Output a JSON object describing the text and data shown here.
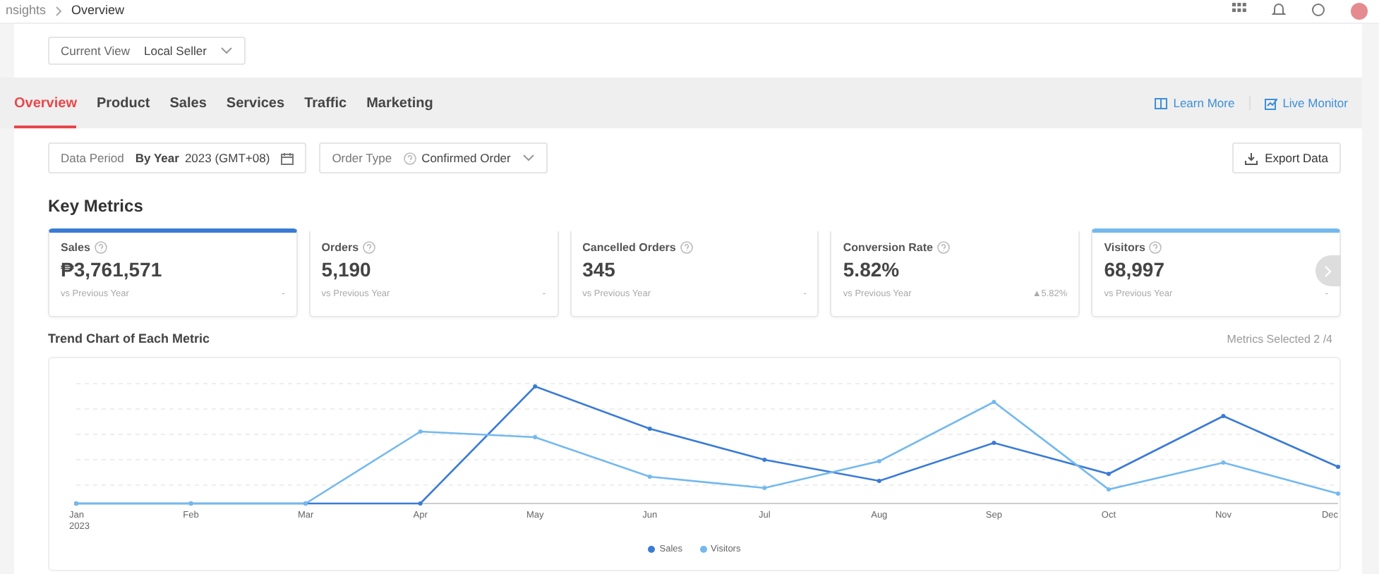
{
  "breadcrumb": [
    "nsights",
    "Overview"
  ],
  "current_view": {
    "label": "Current View",
    "value": "Local Seller"
  },
  "tabs": [
    {
      "label": "Overview",
      "selected": true
    },
    {
      "label": "Product",
      "selected": false
    },
    {
      "label": "Sales",
      "selected": false
    },
    {
      "label": "Services",
      "selected": false
    },
    {
      "label": "Traffic",
      "selected": false
    },
    {
      "label": "Marketing",
      "selected": false
    }
  ],
  "links": [
    "Learn More",
    "Live Monitor"
  ],
  "filters": {
    "data_period": {
      "label": "Data Period",
      "mode": "By Year",
      "value": "2023 (GMT+08)"
    },
    "order_type": {
      "label": "Order Type",
      "value": "Confirmed Order"
    }
  },
  "export_button": "Export Data",
  "key_metrics": {
    "title": "Key Metrics",
    "cards": [
      {
        "name": "Sales",
        "value": "₱3,761,571",
        "comparison": "vs Previous Year",
        "change": "-",
        "selected": true,
        "color": "#3a7bd5"
      },
      {
        "name": "Orders",
        "value": "5,190",
        "comparison": "vs Previous Year",
        "change": "-",
        "selected": false
      },
      {
        "name": "Cancelled Orders",
        "value": "345",
        "comparison": "vs Previous Year",
        "change": "-",
        "selected": false
      },
      {
        "name": "Conversion Rate",
        "value": "5.82%",
        "comparison": "vs Previous Year",
        "change": "▲5.82%",
        "selected": false
      },
      {
        "name": "Visitors",
        "value": "68,997",
        "comparison": "vs Previous Year",
        "change": "-",
        "selected": true,
        "color": "#74b9ee"
      }
    ]
  },
  "trend_chart": {
    "title": "Trend Chart of Each Metric",
    "metrics_selected": "Metrics Selected 2 /4",
    "x_labels": [
      "Jan",
      "Feb",
      "Mar",
      "Apr",
      "May",
      "Jun",
      "Jul",
      "Aug",
      "Sep",
      "Oct",
      "Nov",
      "Dec"
    ],
    "year_label": "2023",
    "legend": [
      {
        "name": "Sales",
        "color": "#3a7bd5"
      },
      {
        "name": "Visitors",
        "color": "#74b9ee"
      }
    ]
  }
}
